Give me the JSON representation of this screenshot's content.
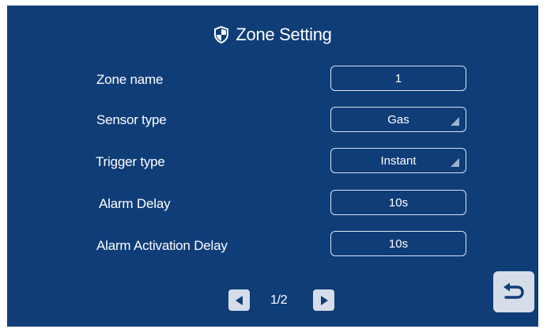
{
  "header": {
    "title": "Zone Setting",
    "icon": "shield-icon"
  },
  "fields": [
    {
      "label": "Zone name",
      "value": "1",
      "dropdown": false
    },
    {
      "label": "Sensor type",
      "value": "Gas",
      "dropdown": true
    },
    {
      "label": "Trigger type",
      "value": "Instant",
      "dropdown": true
    },
    {
      "label": "Alarm Delay",
      "value": "10s",
      "dropdown": false
    },
    {
      "label": "Alarm Activation Delay",
      "value": "10s",
      "dropdown": false
    }
  ],
  "pagination": {
    "page": "1/2"
  },
  "colors": {
    "background": "#0f3d78",
    "button": "#d6dde8",
    "field_border": "#d9e4f2"
  }
}
